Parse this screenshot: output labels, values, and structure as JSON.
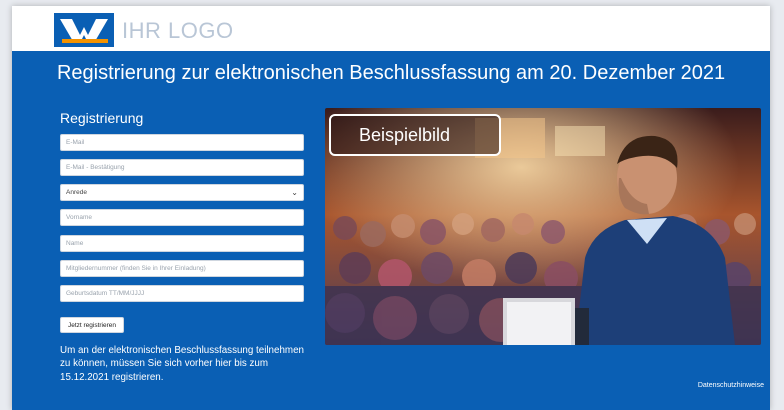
{
  "header": {
    "logo_text": "IHR LOGO",
    "brand_blue": "#0a5fb4",
    "brand_orange": "#f39200"
  },
  "main": {
    "title": "Registrierung zur elektronischen Beschlussfassung am 20. Dezember 2021",
    "section_label": "Registrierung"
  },
  "form": {
    "email_placeholder": "E-Mail",
    "email_confirm_placeholder": "E-Mail - Bestätigung",
    "salutation_selected": "Anrede",
    "firstname_placeholder": "Vorname",
    "lastname_placeholder": "Name",
    "member_number_placeholder": "Mitgliedernummer (finden Sie in Ihrer Einladung)",
    "birthdate_placeholder": "Geburtsdatum TT/MM/JJJJ",
    "submit_label": "Jetzt registrieren"
  },
  "note": "Um an der elektronischen Beschlussfassung teilnehmen zu können, müssen Sie sich vorher hier bis zum 15.12.2021 registrieren.",
  "hero": {
    "badge": "Beispielbild",
    "icon": "conference-speaker-image"
  },
  "footer": {
    "privacy_link": "Datenschutzhinweise"
  }
}
